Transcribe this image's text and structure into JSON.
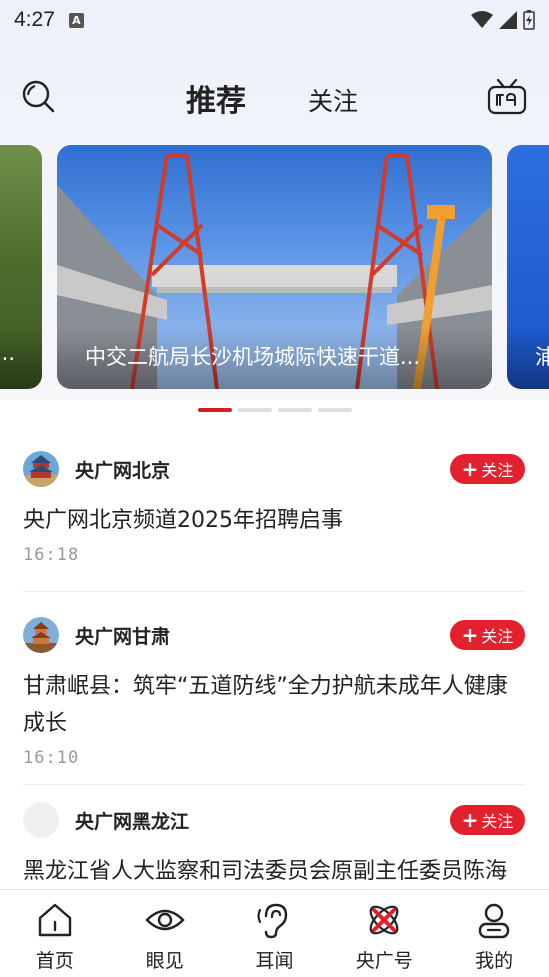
{
  "status_bar": {
    "time": "4:27",
    "notification_badge": "A"
  },
  "nav": {
    "tab_recommend": "推荐",
    "tab_follow": "关注"
  },
  "carousel": {
    "slides": [
      {
        "caption": "..."
      },
      {
        "caption": "中交二航局长沙机场城际快速干道..."
      },
      {
        "caption": "浦"
      }
    ],
    "active_index": 0,
    "dot_count": 4
  },
  "feed": [
    {
      "source": "央广网北京",
      "follow_label": "关注",
      "title": "央广网北京频道2025年招聘启事",
      "time": "16:18"
    },
    {
      "source": "央广网甘肃",
      "follow_label": "关注",
      "title": "甘肃岷县：筑牢“五道防线”全力护航未成年人健康成长",
      "time": "16:10"
    },
    {
      "source": "央广网黑龙江",
      "follow_label": "关注",
      "title": "黑龙江省人大监察和司法委员会原副主任委员陈海东严重违纪违法被开除党籍和公职",
      "time": ""
    }
  ],
  "tabbar": {
    "items": [
      {
        "label": "首页",
        "icon": "home-icon"
      },
      {
        "label": "眼见",
        "icon": "eye-icon"
      },
      {
        "label": "耳闻",
        "icon": "ear-icon"
      },
      {
        "label": "央广号",
        "icon": "cnr-logo-icon"
      },
      {
        "label": "我的",
        "icon": "profile-icon"
      }
    ]
  },
  "colors": {
    "accent": "#e3202e",
    "text": "#222222",
    "muted": "#999999"
  }
}
